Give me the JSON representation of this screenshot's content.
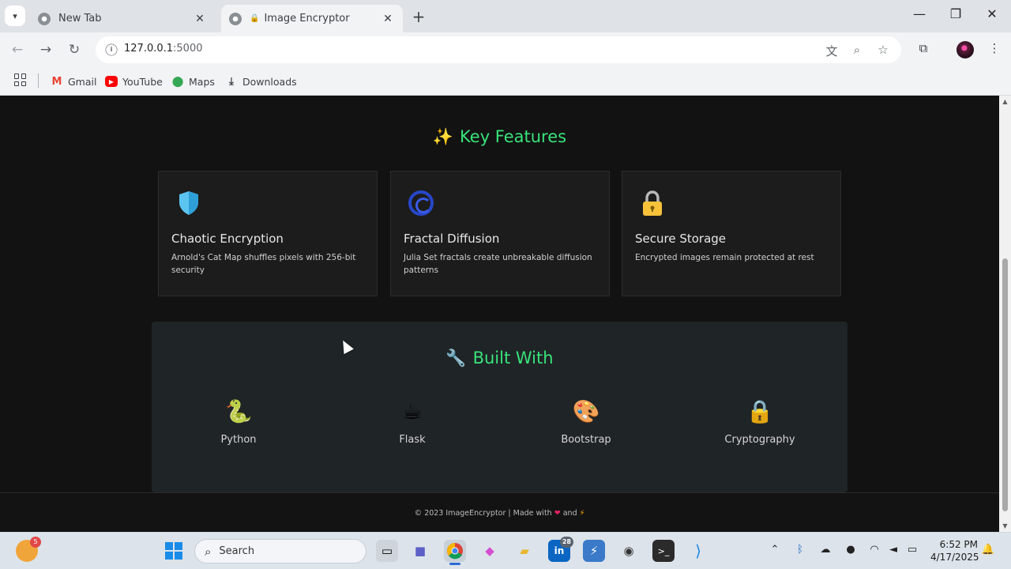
{
  "browser": {
    "tabs": [
      {
        "title": "New Tab",
        "active": false
      },
      {
        "title": "Image Encryptor",
        "active": true
      }
    ],
    "url_host": "127.0.0.1",
    "url_port": ":5000",
    "bookmarks": [
      {
        "label": "Gmail",
        "icon": "gmail-icon"
      },
      {
        "label": "YouTube",
        "icon": "youtube-icon"
      },
      {
        "label": "Maps",
        "icon": "maps-icon"
      },
      {
        "label": "Downloads",
        "icon": "download-icon"
      }
    ]
  },
  "page": {
    "features_title": "Key Features",
    "features_emoji": "✨",
    "features": [
      {
        "title": "Chaotic Encryption",
        "desc": "Arnold's Cat Map shuffles pixels with 256-bit security",
        "icon": "shield-icon"
      },
      {
        "title": "Fractal Diffusion",
        "desc": "Julia Set fractals create unbreakable diffusion patterns",
        "icon": "spiral-icon"
      },
      {
        "title": "Secure Storage",
        "desc": "Encrypted images remain protected at rest",
        "icon": "lock-icon"
      }
    ],
    "built_title": "Built With",
    "built_emoji": "🔧",
    "tech": [
      {
        "label": "Python",
        "icon": "snake-icon",
        "glyph": "🐍"
      },
      {
        "label": "Flask",
        "icon": "coffee-icon",
        "glyph": "☕"
      },
      {
        "label": "Bootstrap",
        "icon": "palette-icon",
        "glyph": "🎨"
      },
      {
        "label": "Cryptography",
        "icon": "lock-icon",
        "glyph": "🔒"
      }
    ],
    "footer_prefix": "© 2023 ImageEncryptor | Made with",
    "footer_and": "and"
  },
  "taskbar": {
    "search_label": "Search",
    "widget_badge": "5",
    "linkedin_badge": "28",
    "time": "6:52 PM",
    "date": "4/17/2025"
  },
  "colors": {
    "accent": "#39e27a",
    "page_bg": "#121212",
    "card_bg": "#1c1c1c"
  }
}
